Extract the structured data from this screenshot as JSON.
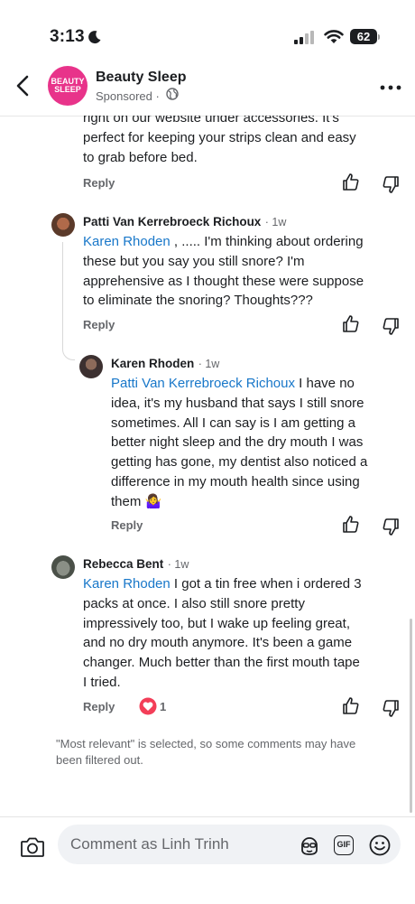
{
  "status_bar": {
    "time": "3:13",
    "battery": "62"
  },
  "header": {
    "brand_logo_line1": "BEAUTY",
    "brand_logo_line2": "SLEEP",
    "title": "Beauty Sleep",
    "subtitle": "Sponsored ·"
  },
  "comments": [
    {
      "text_lines": [
        "right on our website under accessories. It's",
        "perfect for keeping your strips clean and easy",
        "to grab before bed."
      ],
      "reply_label": "Reply"
    },
    {
      "author": "Patti Van Kerrebroeck Richoux",
      "time": "· 1w",
      "mention": "Karen Rhoden",
      "line1_rest": " , ..... I'm thinking about ordering",
      "text_lines": [
        "these but you say you still snore?  I'm",
        "apprehensive as I thought these were suppose",
        "to eliminate the snoring?  Thoughts???"
      ],
      "reply_label": "Reply"
    },
    {
      "author": "Karen Rhoden",
      "time": "· 1w",
      "mention": "Patti Van Kerrebroeck Richoux",
      "line1_rest": " I have no",
      "text_lines": [
        "idea, it's my husband that says I still snore",
        "sometimes. All I can say is I am getting a",
        "better night sleep and the dry mouth I was",
        "getting has gone, my dentist also noticed a",
        "difference in my mouth health since using",
        "them 🤷‍♀️"
      ],
      "reply_label": "Reply"
    },
    {
      "author": "Rebecca Bent",
      "time": "· 1w",
      "mention": "Karen Rhoden",
      "line1_rest": " I got a tin free when i ordered 3",
      "text_lines": [
        "packs at once. I also still snore pretty",
        "impressively too, but I wake up feeling great,",
        "and no dry mouth anymore. It's been a game",
        "changer. Much better than the first mouth tape",
        "I tried."
      ],
      "reply_label": "Reply",
      "reaction_count": "1"
    }
  ],
  "filter_note": "\"Most relevant\" is selected, so some comments may have been filtered out.",
  "composer": {
    "placeholder": "Comment as Linh Trinh",
    "gif_label": "GIF"
  },
  "colors": {
    "mention": "#1877c9",
    "brand": "#e8338a",
    "muted": "#65676b",
    "love": "#f33e58"
  },
  "icons": [
    "back-icon",
    "globe-icon",
    "more-icon",
    "like-icon",
    "dislike-icon",
    "love-reaction-icon",
    "camera-icon",
    "avatar-sticker-icon",
    "gif-icon",
    "emoji-icon"
  ]
}
